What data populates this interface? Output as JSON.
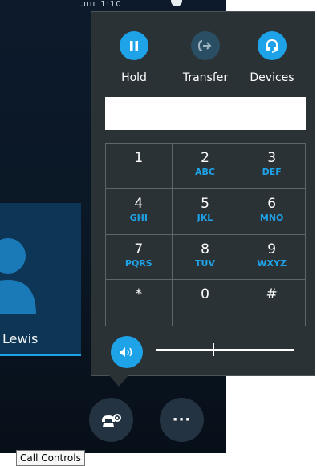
{
  "status": {
    "signal": ".ıııı",
    "time": "1:10"
  },
  "participant": {
    "name": "Lewis"
  },
  "flyout": {
    "actions": [
      {
        "label": "Hold",
        "icon": "pause-icon"
      },
      {
        "label": "Transfer",
        "icon": "transfer-icon"
      },
      {
        "label": "Devices",
        "icon": "headset-icon"
      }
    ],
    "dial_value": "",
    "keypad": [
      {
        "digit": "1",
        "letters": ""
      },
      {
        "digit": "2",
        "letters": "ABC"
      },
      {
        "digit": "3",
        "letters": "DEF"
      },
      {
        "digit": "4",
        "letters": "GHI"
      },
      {
        "digit": "5",
        "letters": "JKL"
      },
      {
        "digit": "6",
        "letters": "MNO"
      },
      {
        "digit": "7",
        "letters": "PQRS"
      },
      {
        "digit": "8",
        "letters": "TUV"
      },
      {
        "digit": "9",
        "letters": "WXYZ"
      },
      {
        "digit": "*",
        "letters": ""
      },
      {
        "digit": "0",
        "letters": ""
      },
      {
        "digit": "#",
        "letters": ""
      }
    ],
    "volume": {
      "level": 0.41,
      "icon": "speaker-icon"
    }
  },
  "controls": {
    "call_controls_icon": "phone-settings-icon",
    "more_label": "···"
  },
  "tooltip": {
    "text": "Call Controls"
  },
  "colors": {
    "accent": "#1ea3e9",
    "flyout_bg": "#2b3236",
    "window_bg": "#0c1a2c"
  }
}
